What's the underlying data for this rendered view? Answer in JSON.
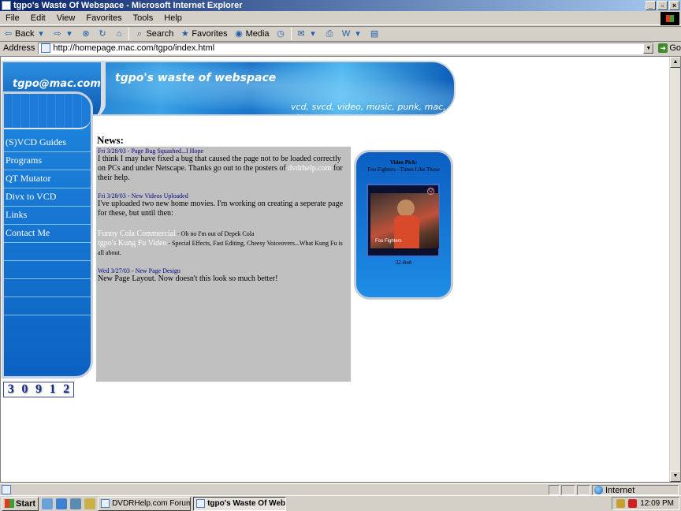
{
  "window": {
    "title": "tgpo's Waste Of Webspace - Microsoft Internet Explorer",
    "buttons": [
      "_",
      "▫",
      "×"
    ]
  },
  "menu": [
    "File",
    "Edit",
    "View",
    "Favorites",
    "Tools",
    "Help"
  ],
  "toolbar": {
    "back_label": "Back",
    "search_label": "Search",
    "favorites_label": "Favorites",
    "media_label": "Media"
  },
  "address": {
    "label": "Address",
    "url": "http://homepage.mac.com/tgpo/index.html",
    "go_label": "Go"
  },
  "banner": {
    "email": "tgpo@mac.com",
    "title": "tgpo's waste of webspace",
    "tagline": "vcd, svcd, video, music, punk, mac, etc..."
  },
  "nav": {
    "items": [
      "(S)VCD Guides",
      "Programs",
      "QT Mutator",
      "Divx to VCD",
      "Links",
      "Contact Me"
    ]
  },
  "counter": {
    "digits": [
      "3",
      "0",
      "9",
      "1",
      "2"
    ]
  },
  "news": {
    "heading": "News:",
    "entries": [
      {
        "date": "Fri 3/28/03 - Page Bug Squashed...I Hope",
        "body_before": "I think I may have fixed a bug that caused the page not to be loaded correctly on PCs and under Netscape. Thanks go out to the posters of ",
        "link": "dvdrhelp.com",
        "body_after": " for their help."
      },
      {
        "date": "Fri 3/28/03 - New Videos Uploaded",
        "body": "I've uploaded two new home movies. I'm working on creating a seperate page for these, but until then:",
        "video1_title": "Funny Cola Commercial",
        "video1_desc": " - Oh no I'm out of Depek Cola",
        "video2_title": "tgpo's Kung Fu Video",
        "video2_desc": " - Special Effects, Fast Editing, Cheesy Voiceovers...What Kung Fu is all about."
      },
      {
        "date": "Wed 3/27/03 - New Page Design",
        "body": "New Page Layout. Now doesn't this look so much better!"
      }
    ]
  },
  "video_pick": {
    "title": "Video Pick:",
    "subtitle": "Foo Fighters - Times Like These",
    "size": "32.4mb",
    "caption": "Foo Fighters"
  },
  "status": {
    "zone": "Internet"
  },
  "taskbar": {
    "start_label": "Start",
    "tasks": [
      "DVDRHelp.com Forums :: ...",
      "tgpo's Waste Of Webs..."
    ],
    "clock": "12:09 PM"
  }
}
